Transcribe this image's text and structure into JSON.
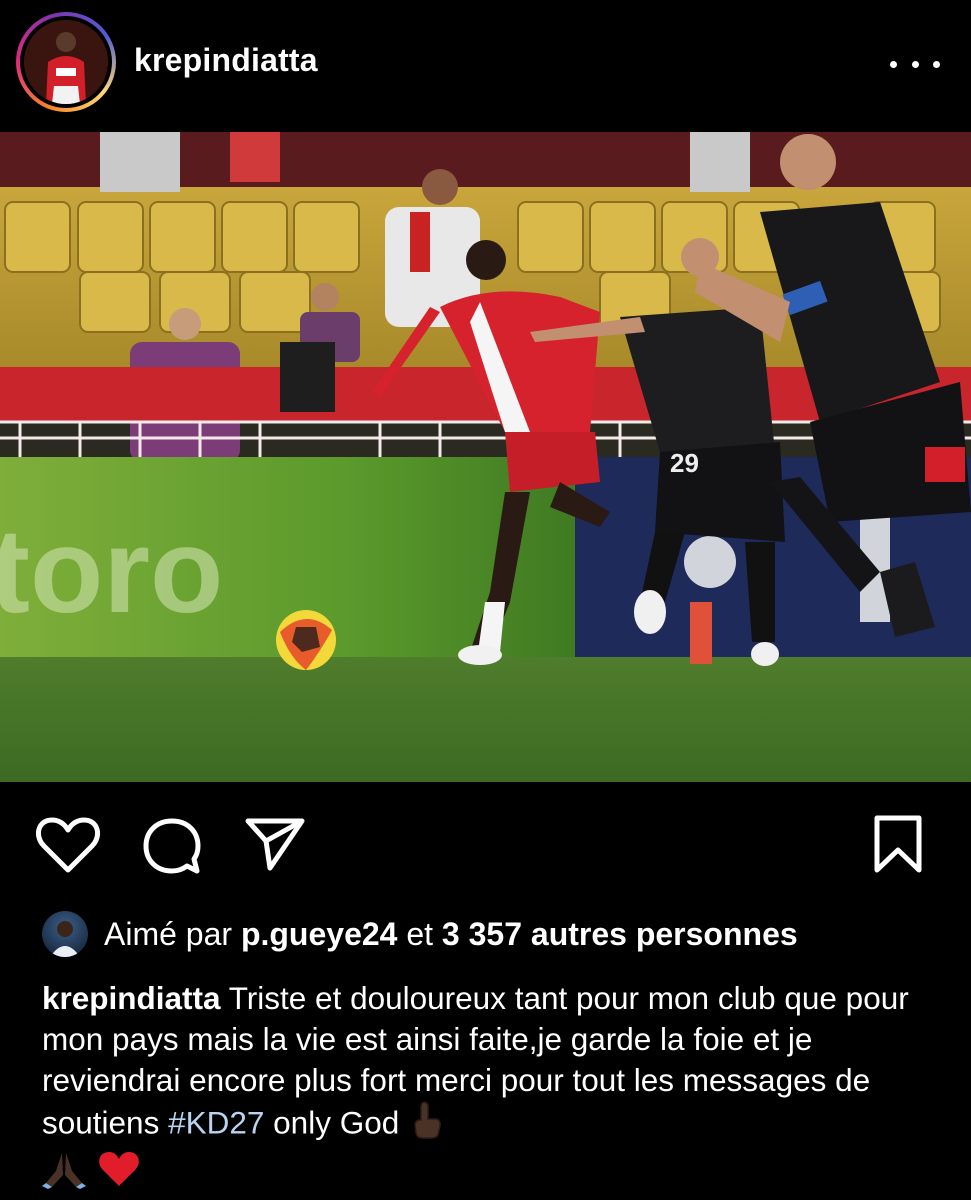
{
  "post": {
    "username": "krepindiatta",
    "more_icon": "more-horizontal-icon"
  },
  "actions": {
    "like_icon": "heart-icon",
    "comment_icon": "comment-icon",
    "share_icon": "send-icon",
    "save_icon": "bookmark-icon"
  },
  "likes": {
    "prefix": "Aimé par",
    "liker": "p.gueye24",
    "connector": "et",
    "count_text": "3 357 autres personnes"
  },
  "caption": {
    "author": "krepindiatta",
    "text": " Triste et douloureux tant pour mon club que pour mon pays mais la vie est ainsi faite,je garde la foie et je reviendrai encore plus fort merci pour tout les messages de soutiens ",
    "hashtag": "#KD27",
    "text_after": " only God ",
    "emojis": [
      "pointing-up-emoji",
      "folded-hands-emoji",
      "red-heart-emoji"
    ]
  },
  "colors": {
    "background": "#000000",
    "text": "#ffffff",
    "hashtag": "#b9d3f0",
    "heart": "#e11d2c"
  }
}
